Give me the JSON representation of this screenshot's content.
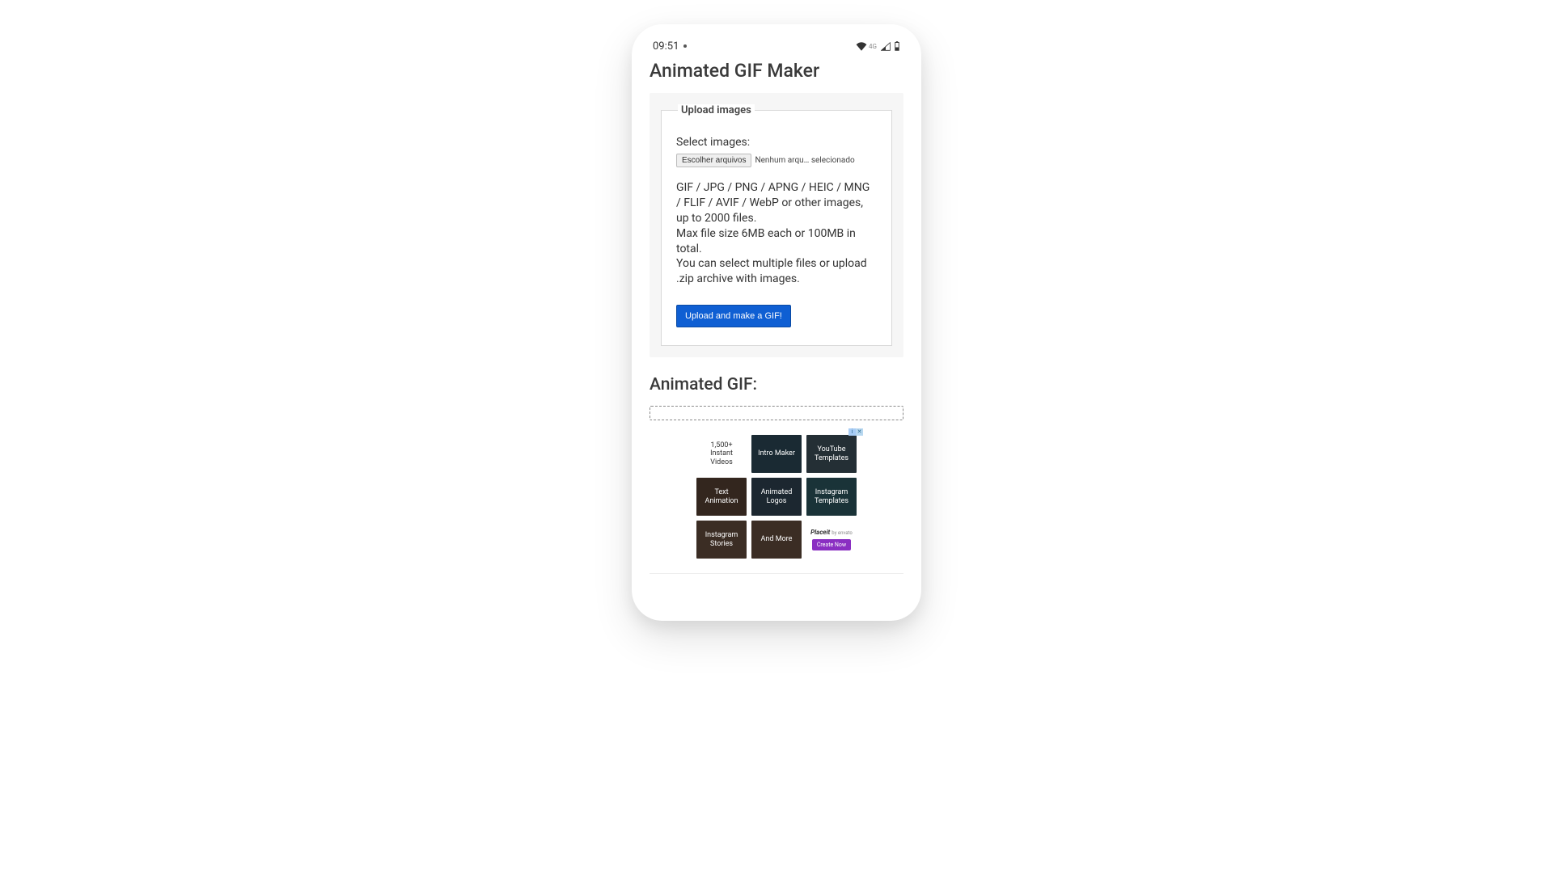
{
  "statusbar": {
    "time": "09:51",
    "network_label": "4G"
  },
  "page": {
    "title": "Animated GIF Maker",
    "output_title": "Animated GIF:"
  },
  "upload": {
    "legend": "Upload images",
    "select_label": "Select images:",
    "file_button": "Escolher arquivos",
    "file_status": "Nenhum arqu… selecionado",
    "formats": "GIF / JPG / PNG / APNG / HEIC / MNG / FLIF / AVIF / WebP or other images, up to 2000 files.",
    "maxsize": "Max file size 6MB each or 100MB in total.",
    "multiple": "You can select multiple files or upload .zip archive with images.",
    "submit": "Upload and make a GIF!"
  },
  "ad": {
    "cells": {
      "c0": "1,500+ Instant Videos",
      "c1": "Intro Maker",
      "c2": "YouTube Templates",
      "c3": "Text Animation",
      "c4": "Animated Logos",
      "c5": "Instagram Templates",
      "c6": "Instagram Stories",
      "c7": "And More"
    },
    "brand_html": "Placeit",
    "brand_by": "by envato",
    "cta": "Create Now"
  }
}
